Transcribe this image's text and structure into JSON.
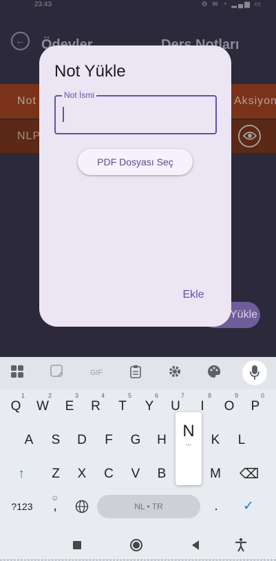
{
  "status_bar": {
    "time": "23:43",
    "icons_text": "⚙ ✉ ◔ ▂▄▆ ▭"
  },
  "app": {
    "title_left": "Ödevler",
    "title_right": "Ders Notları",
    "table": {
      "headers": [
        "Not",
        "Aksiyon"
      ],
      "rows": [
        {
          "name": "NLP"
        }
      ]
    },
    "upload_fab_label": "Yükle"
  },
  "dialog": {
    "title": "Not Yükle",
    "field": {
      "label": "Not İsmi",
      "value": ""
    },
    "pdf_button_label": "PDF Dosyası Seç",
    "add_button_label": "Ekle"
  },
  "keyboard": {
    "toolbar": [
      "apps-grid-icon",
      "sticker-icon",
      "GIF",
      "clipboard-icon",
      "settings-icon",
      "palette-icon",
      "mic-icon"
    ],
    "rows": [
      [
        {
          "k": "Q",
          "h": "1"
        },
        {
          "k": "W",
          "h": "2"
        },
        {
          "k": "E",
          "h": "3"
        },
        {
          "k": "R",
          "h": "4"
        },
        {
          "k": "T",
          "h": "5"
        },
        {
          "k": "Y",
          "h": "6"
        },
        {
          "k": "U",
          "h": "7"
        },
        {
          "k": "I",
          "h": "8"
        },
        {
          "k": "O",
          "h": "9"
        },
        {
          "k": "P",
          "h": "0"
        }
      ],
      [
        {
          "k": "A"
        },
        {
          "k": "S"
        },
        {
          "k": "D"
        },
        {
          "k": "F"
        },
        {
          "k": "G"
        },
        {
          "k": "H"
        },
        {
          "k": "J"
        },
        {
          "k": "K"
        },
        {
          "k": "L"
        }
      ],
      [
        {
          "k": "↑"
        },
        {
          "k": "Z"
        },
        {
          "k": "X"
        },
        {
          "k": "C"
        },
        {
          "k": "V"
        },
        {
          "k": "B"
        },
        {
          "k": "N"
        },
        {
          "k": "M"
        },
        {
          "k": "⌫"
        }
      ]
    ],
    "popup_key": "N",
    "popup_dots": "...",
    "sym_key": "?123",
    "comma_key": ",",
    "spacebar_label": "NL • TR",
    "period_key": ".",
    "enter_key": "✓"
  },
  "colors": {
    "accent": "#6750a4",
    "dialog_bg": "#ece5f3",
    "table_header": "#7a3318",
    "table_row": "#5b2916"
  }
}
